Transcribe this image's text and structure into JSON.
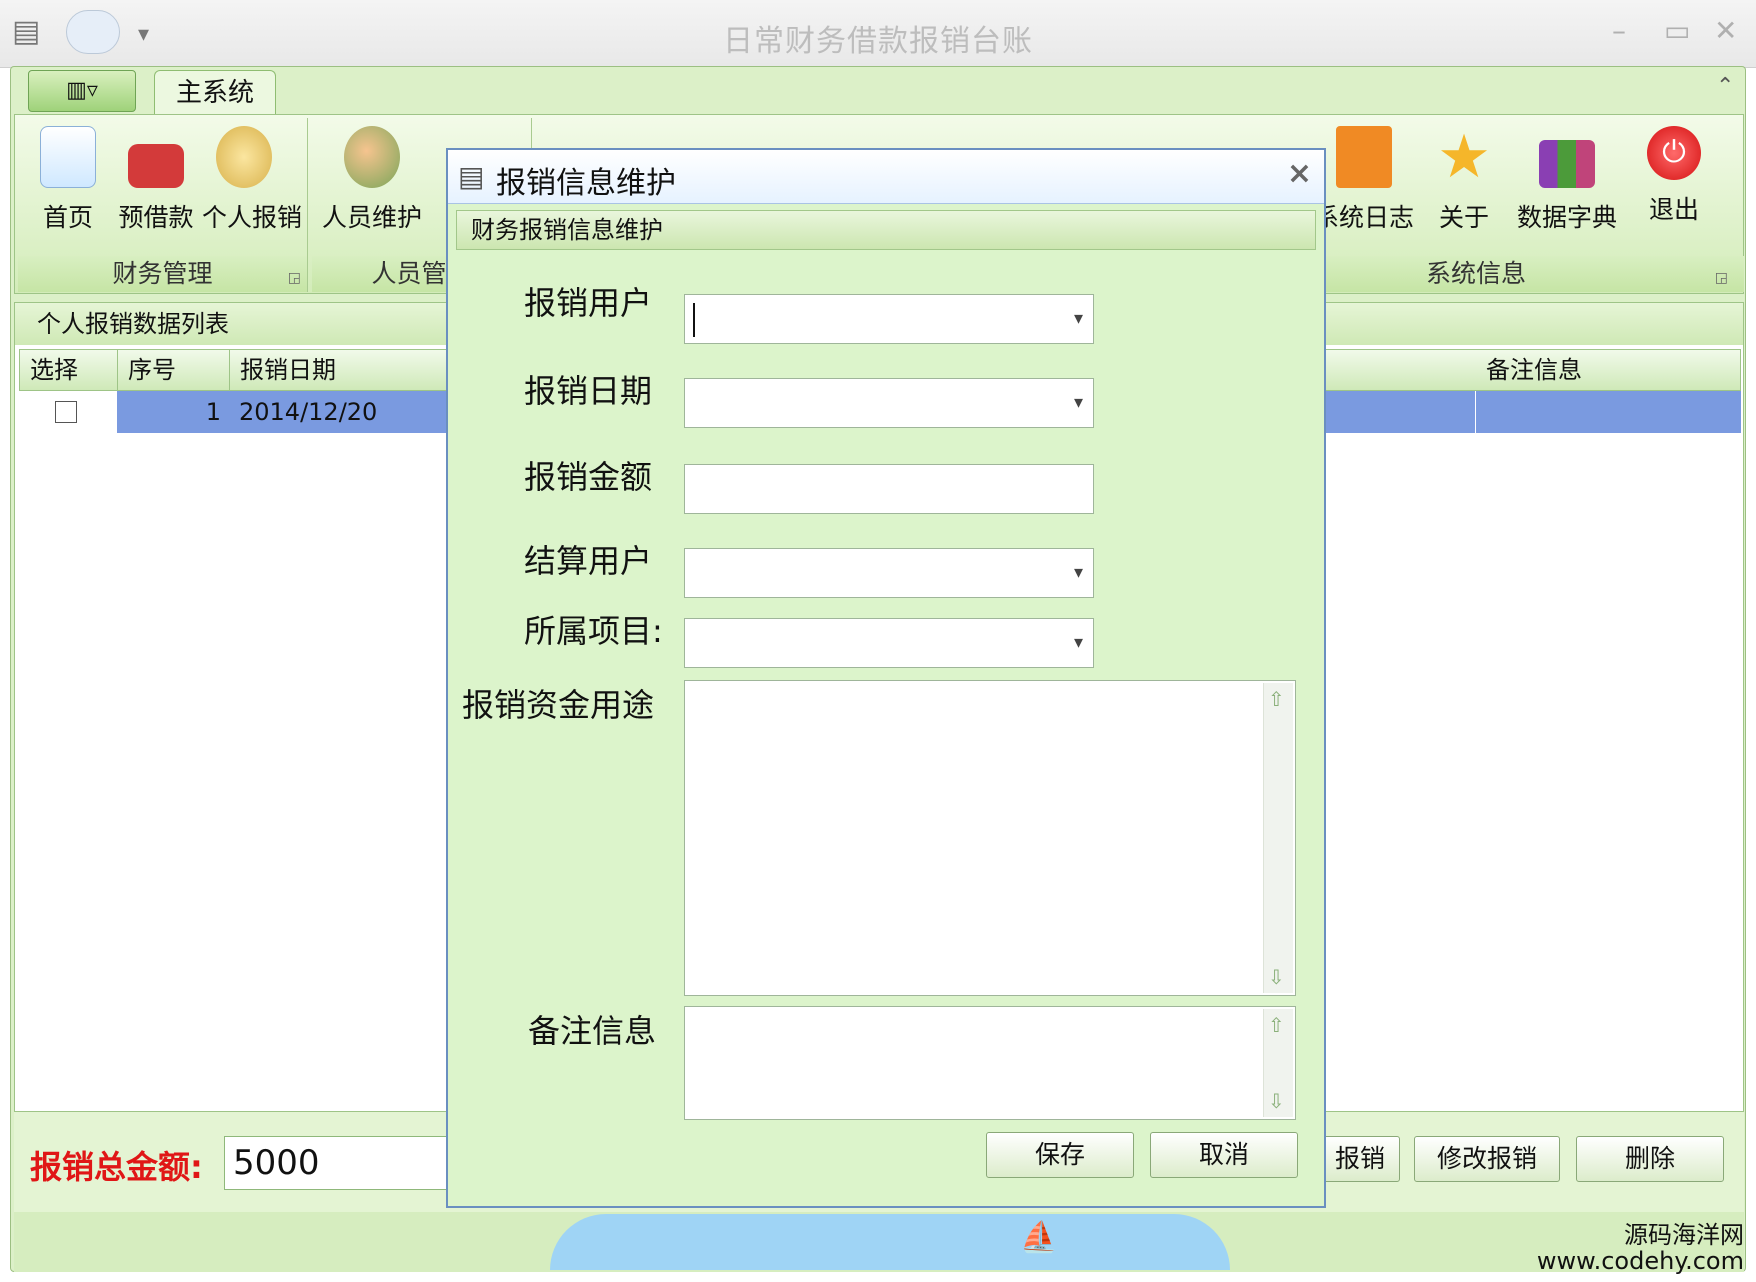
{
  "window": {
    "title": "日常财务借款报销台账"
  },
  "ribbon": {
    "main_tab": "主系统",
    "groups": [
      {
        "label": "财务管理",
        "buttons": [
          "首页",
          "预借款",
          "个人报销"
        ]
      },
      {
        "label": "人员管理",
        "buttons": [
          "人员维护"
        ]
      },
      {
        "label": "系统信息",
        "buttons": [
          "系统日志",
          "关于",
          "数据字典",
          "退出"
        ]
      }
    ]
  },
  "list": {
    "title": "个人报销数据列表",
    "columns": [
      "选择",
      "序号",
      "报销日期",
      "备注信息"
    ],
    "rows": [
      {
        "index": "1",
        "date": "2014/12/20",
        "note": ""
      }
    ]
  },
  "bottom": {
    "total_label": "报销总金额:",
    "total_value": "5000",
    "buttons": [
      "报销",
      "修改报销",
      "删除"
    ]
  },
  "dialog": {
    "title": "报销信息维护",
    "subtitle": "财务报销信息维护",
    "fields": {
      "user": "报销用户",
      "date": "报销日期",
      "amount": "报销金额",
      "settle_user": "结算用户",
      "project": "所属项目:",
      "purpose": "报销资金用途",
      "note": "备注信息"
    },
    "buttons": {
      "save": "保存",
      "cancel": "取消"
    }
  },
  "watermark": {
    "line1": "源码海洋网",
    "line2": "www.codehy.com"
  },
  "colors": {
    "accent_green": "#dcf0c8",
    "selected_row": "#7a9ae0",
    "total_red": "#e01616",
    "dialog_border": "#6a8fc0"
  }
}
